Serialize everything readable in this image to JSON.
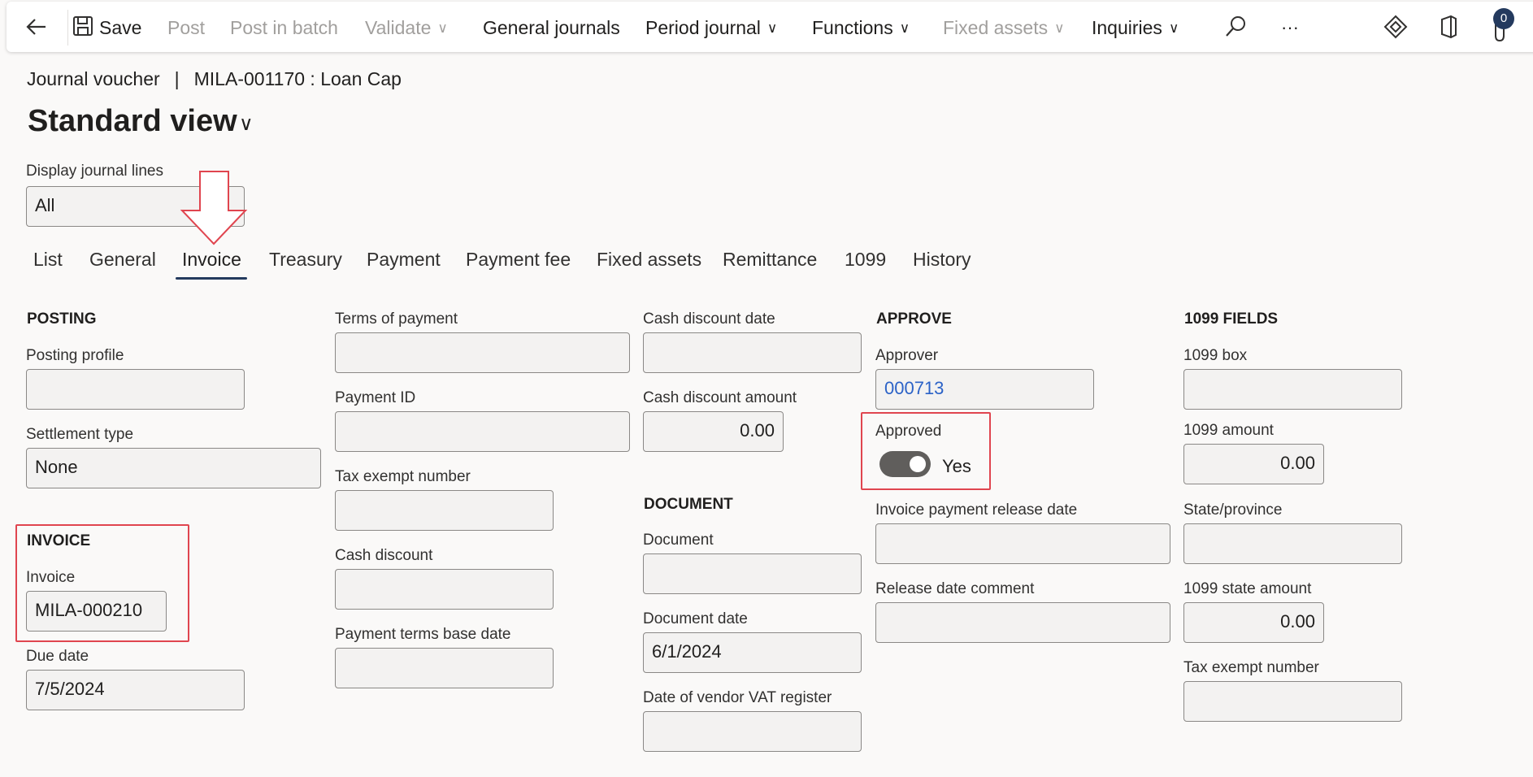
{
  "toolbar": {
    "save": "Save",
    "post": "Post",
    "post_in_batch": "Post in batch",
    "validate": "Validate",
    "general_journals": "General journals",
    "period_journal": "Period journal",
    "functions": "Functions",
    "fixed_assets": "Fixed assets",
    "inquiries": "Inquiries",
    "more": "···",
    "attachments_count": "0",
    "icons": [
      "back-arrow-icon",
      "save-icon",
      "chevron-down-icon",
      "search-icon",
      "more-icon",
      "diamond-icon",
      "office-icon",
      "attachment-icon"
    ]
  },
  "header": {
    "breadcrumb_left": "Journal voucher",
    "breadcrumb_sep": "|",
    "breadcrumb_right": "MILA-001170 : Loan Cap",
    "view_title": "Standard view"
  },
  "display_lines": {
    "label": "Display journal lines",
    "value": "All"
  },
  "tabs": [
    "List",
    "General",
    "Invoice",
    "Treasury",
    "Payment",
    "Payment fee",
    "Fixed assets",
    "Remittance",
    "1099",
    "History"
  ],
  "posting": {
    "heading": "POSTING",
    "posting_profile_label": "Posting profile",
    "posting_profile_value": "",
    "settlement_type_label": "Settlement type",
    "settlement_type_value": "None"
  },
  "invoice": {
    "heading": "INVOICE",
    "invoice_label": "Invoice",
    "invoice_value": "MILA-000210",
    "due_date_label": "Due date",
    "due_date_value": "7/5/2024"
  },
  "payment_col": {
    "terms_label": "Terms of payment",
    "payment_id_label": "Payment ID",
    "tax_exempt_label": "Tax exempt number",
    "cash_discount_label": "Cash discount",
    "terms_base_date_label": "Payment terms base date"
  },
  "discount_col": {
    "cash_discount_date_label": "Cash discount date",
    "cash_discount_amount_label": "Cash discount amount",
    "cash_discount_amount_value": "0.00"
  },
  "document": {
    "heading": "DOCUMENT",
    "document_label": "Document",
    "document_date_label": "Document date",
    "document_date_value": "6/1/2024",
    "vat_register_label": "Date of vendor VAT register"
  },
  "approve": {
    "heading": "APPROVE",
    "approver_label": "Approver",
    "approver_value": "000713",
    "approved_label": "Approved",
    "approved_value": "Yes",
    "approved_on": true,
    "release_date_label": "Invoice payment release date",
    "release_comment_label": "Release date comment"
  },
  "fields_1099": {
    "heading": "1099 FIELDS",
    "box_label": "1099 box",
    "amount_label": "1099 amount",
    "amount_value": "0.00",
    "state_label": "State/province",
    "state_amount_label": "1099 state amount",
    "state_amount_value": "0.00",
    "tax_exempt_label": "Tax exempt number"
  },
  "colors": {
    "accent": "#243a5e",
    "highlight": "#e0454f",
    "link": "#2b62c7"
  }
}
